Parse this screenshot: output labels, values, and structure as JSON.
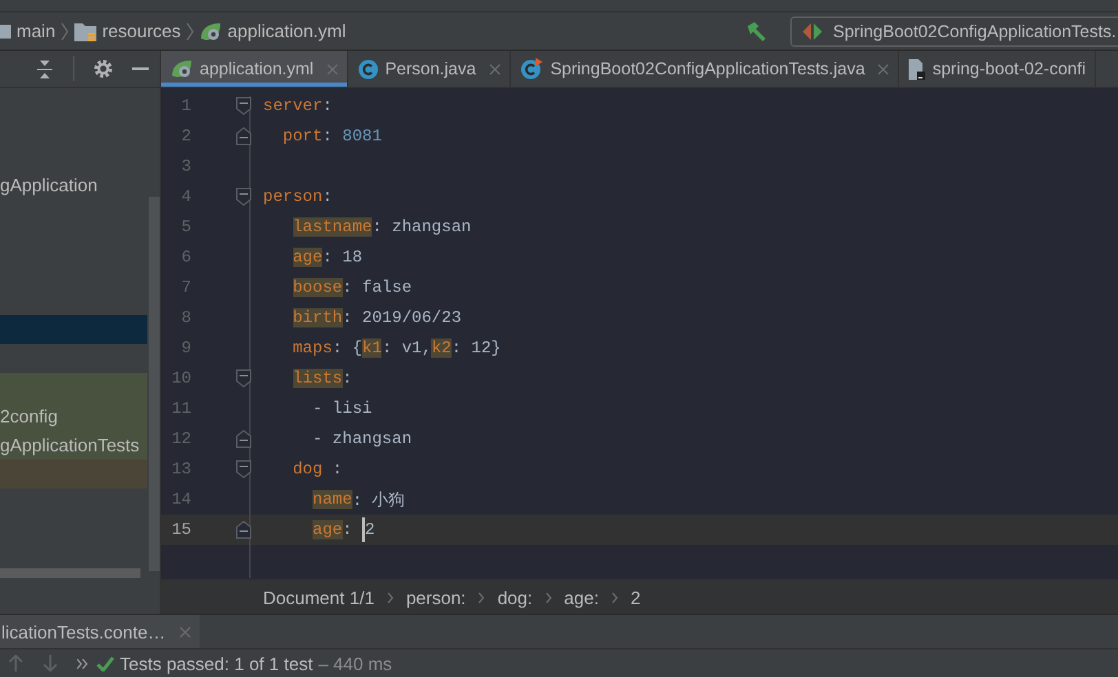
{
  "breadcrumb": [
    {
      "label": "main",
      "kind": "module"
    },
    {
      "label": "resources",
      "kind": "folder"
    },
    {
      "label": "application.yml",
      "kind": "yml"
    }
  ],
  "run_config": {
    "label": "SpringBoot02ConfigApplicationTests."
  },
  "tabs": [
    {
      "label": "application.yml",
      "kind": "yml",
      "selected": true,
      "closable": true
    },
    {
      "label": "Person.java",
      "kind": "class",
      "selected": false,
      "closable": true
    },
    {
      "label": "SpringBoot02ConfigApplicationTests.java",
      "kind": "test-class",
      "selected": false,
      "closable": true
    },
    {
      "label": "spring-boot-02-confi",
      "kind": "file",
      "selected": false,
      "closable": false
    }
  ],
  "project_rows": [
    {
      "label": "gApplication",
      "selected": false
    },
    {
      "selected": true
    },
    {
      "selected": false,
      "color": "#48523f"
    },
    {
      "label": "2config",
      "selected": false,
      "color": "#48523f"
    },
    {
      "label": "gApplicationTests",
      "selected": false,
      "color": "#48523f"
    },
    {
      "selected": false,
      "color": "#4b4538"
    }
  ],
  "code_lines": [
    {
      "number": "1",
      "fold_open": true,
      "fold_close": false,
      "current": false,
      "caret": false,
      "segments": [
        {
          "kind": "key",
          "text": "server"
        },
        {
          "kind": "plain",
          "text": ":"
        }
      ]
    },
    {
      "number": "2",
      "fold_open": false,
      "fold_close": true,
      "current": false,
      "caret": false,
      "segments": [
        {
          "kind": "key",
          "text": "  port"
        },
        {
          "kind": "plain",
          "text": ": "
        },
        {
          "kind": "number",
          "text": "8081"
        }
      ]
    },
    {
      "number": "3",
      "fold_open": false,
      "fold_close": false,
      "current": false,
      "caret": false
    },
    {
      "number": "4",
      "fold_open": true,
      "fold_close": false,
      "current": false,
      "caret": false,
      "segments": [
        {
          "kind": "key",
          "text": "person"
        },
        {
          "kind": "plain",
          "text": ":"
        }
      ]
    },
    {
      "number": "5",
      "fold_open": false,
      "fold_close": false,
      "current": false,
      "caret": false,
      "segments": [
        {
          "kind": "key-marked",
          "text": "   lastname"
        },
        {
          "kind": "plain",
          "text": ": zhangsan"
        }
      ]
    },
    {
      "number": "6",
      "fold_open": false,
      "fold_close": false,
      "current": false,
      "caret": false,
      "segments": [
        {
          "kind": "key-marked",
          "text": "   age"
        },
        {
          "kind": "plain",
          "text": ": 18"
        }
      ]
    },
    {
      "number": "7",
      "fold_open": false,
      "fold_close": false,
      "current": false,
      "caret": false,
      "segments": [
        {
          "kind": "key-marked",
          "text": "   boose"
        },
        {
          "kind": "plain",
          "text": ": false"
        }
      ]
    },
    {
      "number": "8",
      "fold_open": false,
      "fold_close": false,
      "current": false,
      "caret": false,
      "segments": [
        {
          "kind": "key-marked",
          "text": "   birth"
        },
        {
          "kind": "plain",
          "text": ": 2019/06/23"
        }
      ]
    },
    {
      "number": "9",
      "fold_open": false,
      "fold_close": false,
      "current": false,
      "caret": false,
      "segments": [
        {
          "kind": "key",
          "text": "   maps"
        },
        {
          "kind": "plain",
          "text": ": {"
        },
        {
          "kind": "key-marked",
          "text": "k1"
        },
        {
          "kind": "plain",
          "text": ": v1,"
        },
        {
          "kind": "key-marked",
          "text": "k2"
        },
        {
          "kind": "plain",
          "text": ": 12}"
        }
      ]
    },
    {
      "number": "10",
      "fold_open": true,
      "fold_close": false,
      "current": false,
      "caret": false,
      "segments": [
        {
          "kind": "key-marked",
          "text": "   lists"
        },
        {
          "kind": "plain",
          "text": ":"
        }
      ]
    },
    {
      "number": "11",
      "fold_open": false,
      "fold_close": false,
      "current": false,
      "caret": false,
      "segments": [
        {
          "kind": "plain",
          "text": "     - lisi"
        }
      ]
    },
    {
      "number": "12",
      "fold_open": false,
      "fold_close": true,
      "current": false,
      "caret": false,
      "segments": [
        {
          "kind": "plain",
          "text": "     - zhangsan"
        }
      ]
    },
    {
      "number": "13",
      "fold_open": true,
      "fold_close": false,
      "current": false,
      "caret": false,
      "segments": [
        {
          "kind": "key",
          "text": "   dog"
        },
        {
          "kind": "plain",
          "text": " :"
        }
      ]
    },
    {
      "number": "14",
      "fold_open": false,
      "fold_close": false,
      "current": false,
      "caret": false,
      "segments": [
        {
          "kind": "key-marked",
          "text": "     name"
        },
        {
          "kind": "plain",
          "text": ": 小狗"
        }
      ]
    },
    {
      "number": "15",
      "fold_open": false,
      "fold_close": true,
      "current": true,
      "caret": true,
      "segments": [
        {
          "kind": "key-marked",
          "text": "     age"
        },
        {
          "kind": "plain",
          "text": ": "
        },
        {
          "kind": "plain",
          "text": "2"
        }
      ]
    }
  ],
  "editor_breadcrumb": [
    "Document 1/1",
    "person:",
    "dog:",
    "age:",
    "2"
  ],
  "bottom_tab": {
    "label": "licationTests.conte…"
  },
  "test_status": {
    "text": "Tests passed: 1 of 1 test",
    "duration": "– 440 ms",
    "passed": true
  }
}
